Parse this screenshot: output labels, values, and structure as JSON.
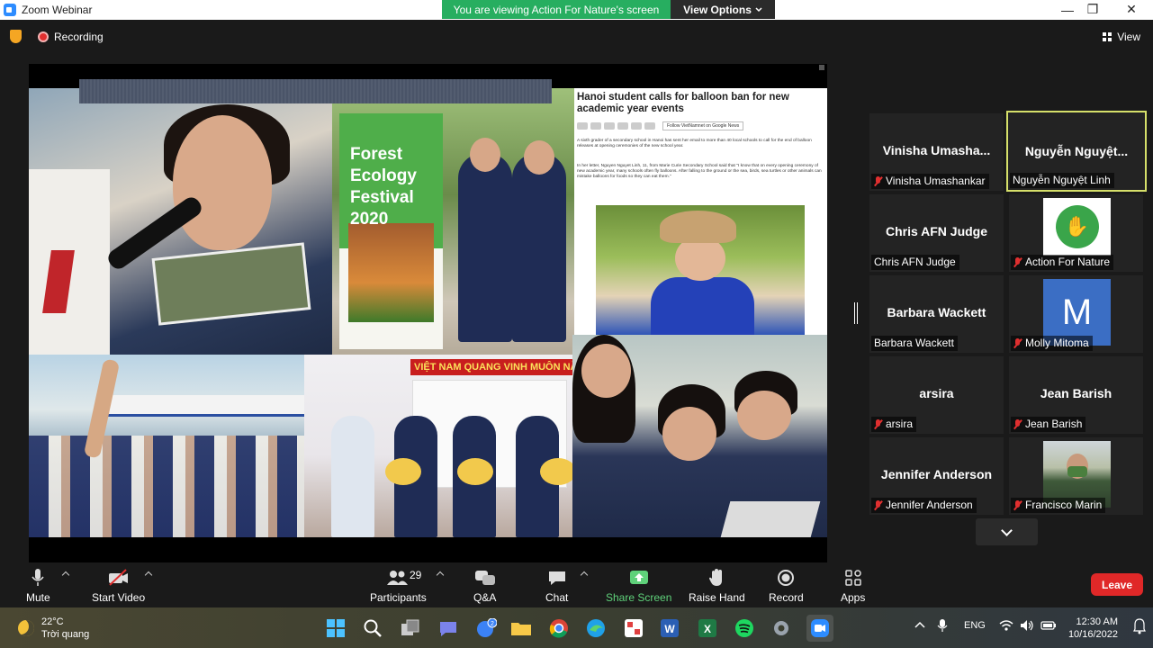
{
  "window": {
    "title": "Zoom Webinar",
    "viewing_banner": "You are viewing Action For Nature's screen",
    "view_options": "View Options",
    "minimize": "—",
    "maximize": "❐",
    "close": "✕"
  },
  "topbar": {
    "recording": "Recording",
    "view": "View"
  },
  "shared_screen": {
    "collage_text": {
      "forest_banner": "Forest\nEcology\nFestival\n2020",
      "article_headline": "Hanoi student calls for balloon ban for new academic year events",
      "article_follow": "Follow VietNamnet on Google News",
      "article_para1": "A sixth grader of a secondary school in Hanoi has sent her email to more than 40 local schools to call for the end of balloon releases at opening ceremonies of the new school year.",
      "article_para2": "In her letter, Nguyen Nguyet Linh, 11, from Marie Curie Secondary School said that \"I know that on every opening ceremony of new academic year, many schools often fly balloons. After falling to the ground or the sea, birds, sea turtles or other animals can mistake balloons for foods so they can eat them.\"",
      "vietnam_banner": "VIỆT NAM QUANG VINH MUÔN NĂ"
    }
  },
  "participants": [
    {
      "big_name": "Vinisha  Umasha...",
      "name": "Vinisha Umashankar",
      "muted": true,
      "avatar": "none",
      "active": false
    },
    {
      "big_name": "Nguyễn  Nguyệt...",
      "name": "Nguyễn Nguyệt Linh",
      "muted": false,
      "avatar": "none",
      "active": true
    },
    {
      "big_name": "Chris AFN Judge",
      "name": "Chris AFN Judge",
      "muted": false,
      "avatar": "none",
      "active": false
    },
    {
      "big_name": "",
      "name": "Action For Nature",
      "muted": true,
      "avatar": "action-for-nature-logo",
      "active": false
    },
    {
      "big_name": "Barbara Wackett",
      "name": "Barbara Wackett",
      "muted": false,
      "avatar": "none",
      "active": false
    },
    {
      "big_name": "",
      "name": "Molly Mitoma",
      "muted": true,
      "avatar": "M",
      "active": false
    },
    {
      "big_name": "arsira",
      "name": "arsira",
      "muted": true,
      "avatar": "none",
      "active": false
    },
    {
      "big_name": "Jean Barish",
      "name": "Jean Barish",
      "muted": true,
      "avatar": "none",
      "active": false
    },
    {
      "big_name": "Jennifer Anderson",
      "name": "Jennifer Anderson",
      "muted": true,
      "avatar": "none",
      "active": false
    },
    {
      "big_name": "",
      "name": "Francisco Marin",
      "muted": true,
      "avatar": "photo",
      "active": false
    }
  ],
  "toolbar": {
    "mute": "Mute",
    "start_video": "Start Video",
    "participants": "Participants",
    "participants_count": "29",
    "qa": "Q&A",
    "chat": "Chat",
    "share_screen": "Share Screen",
    "raise_hand": "Raise Hand",
    "record": "Record",
    "apps": "Apps",
    "leave": "Leave"
  },
  "taskbar": {
    "temperature": "22°C",
    "weather": "Trời quang",
    "language": "ENG",
    "time": "12:30 AM",
    "date": "10/16/2022",
    "zoom_badge": "2"
  },
  "colors": {
    "banner_green": "#27ae60",
    "leave_red": "#e02828",
    "active_speaker": "#d6e06a",
    "share_screen_green": "#5fd17a"
  }
}
